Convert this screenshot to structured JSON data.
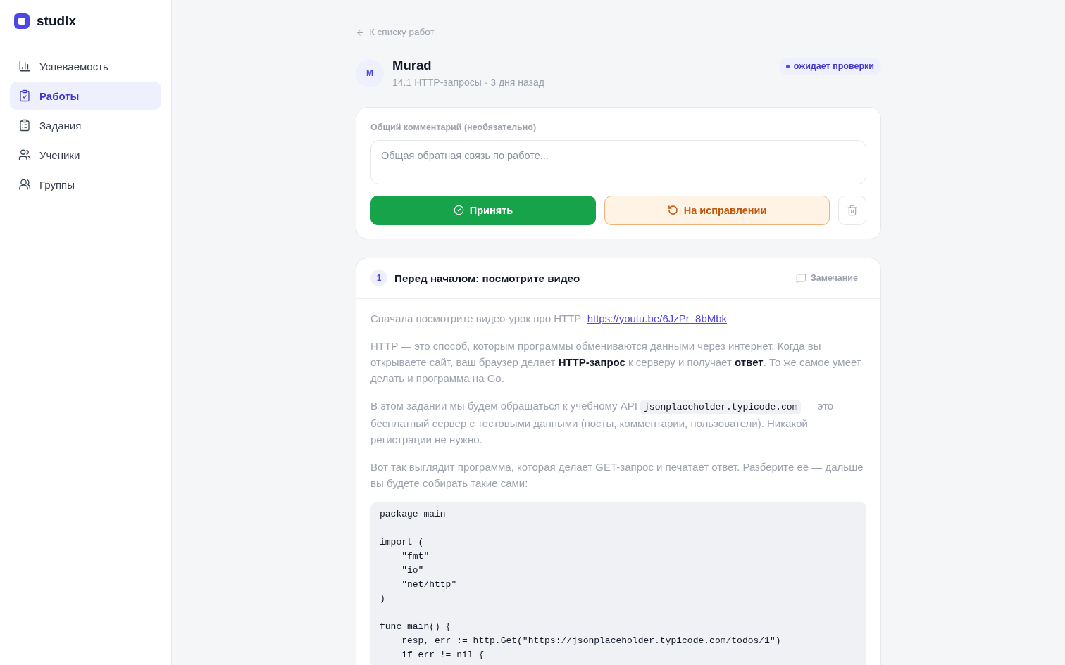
{
  "sidebar": {
    "logo": "studix",
    "items": [
      {
        "label": "Успеваемость",
        "selected": false
      },
      {
        "label": "Работы",
        "selected": true
      },
      {
        "label": "Задания",
        "selected": false
      },
      {
        "label": "Ученики",
        "selected": false
      },
      {
        "label": "Группы",
        "selected": false
      }
    ]
  },
  "back_link": "К списку работ",
  "submission": {
    "avatar_initial": "M",
    "student": "Murad",
    "meta": "14.1 HTTP-запросы · 3 дня назад",
    "status_badge": "ожидает проверки"
  },
  "review": {
    "label": "Общий комментарий (необязательно)",
    "comment": {
      "placeholder": "Общая обратная связь по работе..."
    },
    "actions": [
      {
        "kind": "accept",
        "label": "Принять"
      },
      {
        "kind": "revise",
        "label": "На исправлении"
      },
      {
        "kind": "delete"
      }
    ]
  },
  "task": {
    "number": "1",
    "title": "Перед началом: посмотрите видео",
    "remark_button": "Замечание",
    "paragraphs": [
      {
        "text": "Сначала посмотрите видео-урок про HTTP:",
        "link": "https://youtu.be/6JzPr_8bMbk"
      },
      {
        "text": "HTTP — это способ, которым программы обмениваются данными через интернет. Когда вы открываете сайт, ваш браузер делает **HTTP-запрос** к серверу и получает **ответ**. То же самое умеет делать и программа на Go."
      },
      {
        "text": "В этом задании мы будем обращаться к учебному API",
        "code": "jsonplaceholder.typicode.com",
        "text_after": "— это бесплатный сервер с тестовыми данными (посты, комментарии, пользователи). Никакой регистрации не нужно."
      },
      {
        "text": "Вот так выглядит программа, которая делает GET-запрос и печатает ответ. Разберите её — дальше вы будете собирать такие сами:"
      }
    ],
    "code_block": "package main\n\nimport (\n    \"fmt\"\n    \"io\"\n    \"net/http\"\n)\n\nfunc main() {\n    resp, err := http.Get(\"https://jsonplaceholder.typicode.com/todos/1\")\n    if err != nil {"
  }
}
